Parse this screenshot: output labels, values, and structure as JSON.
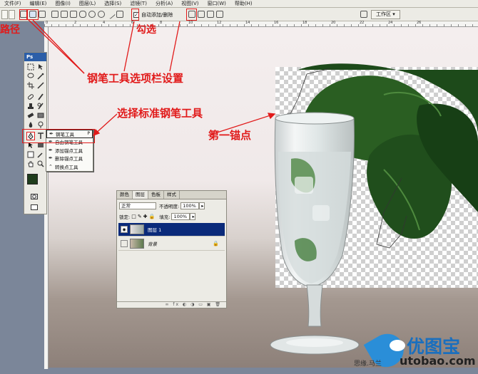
{
  "menu": {
    "items": [
      "文件(F)",
      "编辑(E)",
      "图像(I)",
      "图层(L)",
      "选择(S)",
      "滤镜(T)",
      "分析(A)",
      "视图(V)",
      "窗口(W)",
      "帮助(H)"
    ]
  },
  "options_bar": {
    "auto_add_label": "自动添加/删除",
    "auto_add_checked": true,
    "workspace_label": "工作区 ▾"
  },
  "ruler": {
    "labels": [
      "0",
      "2",
      "4",
      "6",
      "8",
      "10",
      "12",
      "14",
      "16",
      "18",
      "20",
      "22",
      "24",
      "26"
    ]
  },
  "tools": {
    "header": "Ps",
    "flyout": [
      {
        "icon": "pen-icon",
        "label": "钢笔工具",
        "key": "P",
        "selected": true
      },
      {
        "icon": "freeform-pen-icon",
        "label": "自由钢笔工具",
        "key": "",
        "selected": false
      },
      {
        "icon": "add-anchor-icon",
        "label": "添加锚点工具",
        "key": "",
        "selected": false
      },
      {
        "icon": "delete-anchor-icon",
        "label": "删除锚点工具",
        "key": "",
        "selected": false
      },
      {
        "icon": "convert-point-icon",
        "label": "转换点工具",
        "key": "",
        "selected": false
      }
    ],
    "foreground_color": "#1f3d1c",
    "background_color": "#ffffff"
  },
  "layers_panel": {
    "tabs": [
      "颜色",
      "图层",
      "色板",
      "样式"
    ],
    "active_tab": "图层",
    "blend_mode": "正常",
    "opacity_label": "不透明度:",
    "opacity_value": "100%",
    "lock_label": "锁定:",
    "fill_label": "填充:",
    "fill_value": "100%",
    "layers": [
      {
        "name": "图层 1",
        "active": true,
        "visible": true
      },
      {
        "name": "背景",
        "active": false,
        "visible": false,
        "locked": true
      }
    ]
  },
  "annotations": {
    "path_label": "路径",
    "check_label": "勾选",
    "pen_options_label": "钢笔工具选项栏设置",
    "select_pen_label": "选择标准钢笔工具",
    "first_anchor_label": "第一锚点"
  },
  "watermark": {
    "brand": "优图宝",
    "url": "utobao.com",
    "side_text": "思缘.马兰"
  },
  "colors": {
    "annotation_red": "#e11b1b",
    "selected_layer": "#0a2a7a",
    "ps_blue": "#2b5ea8"
  }
}
